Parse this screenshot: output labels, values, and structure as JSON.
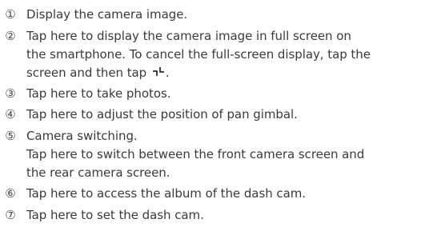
{
  "items": [
    {
      "marker": "①",
      "lines": [
        "Display the camera image."
      ]
    },
    {
      "marker": "②",
      "lines": [
        "Tap here to display the camera image in full screen on",
        "the smartphone. To cancel the full-screen display, tap the",
        "screen and then tap",
        "."
      ],
      "icon": "exit-fullscreen-icon"
    },
    {
      "marker": "③",
      "lines": [
        "Tap here to take photos."
      ]
    },
    {
      "marker": "④",
      "lines": [
        "Tap here to adjust the position of pan gimbal."
      ]
    },
    {
      "marker": "⑤",
      "lines": [
        "Camera switching.",
        "Tap here to switch between the front camera screen and",
        "the rear camera screen."
      ]
    },
    {
      "marker": "⑥",
      "lines": [
        "Tap here to access the album of the dash cam."
      ]
    },
    {
      "marker": "⑦",
      "lines": [
        "Tap here to set the dash cam."
      ]
    }
  ]
}
